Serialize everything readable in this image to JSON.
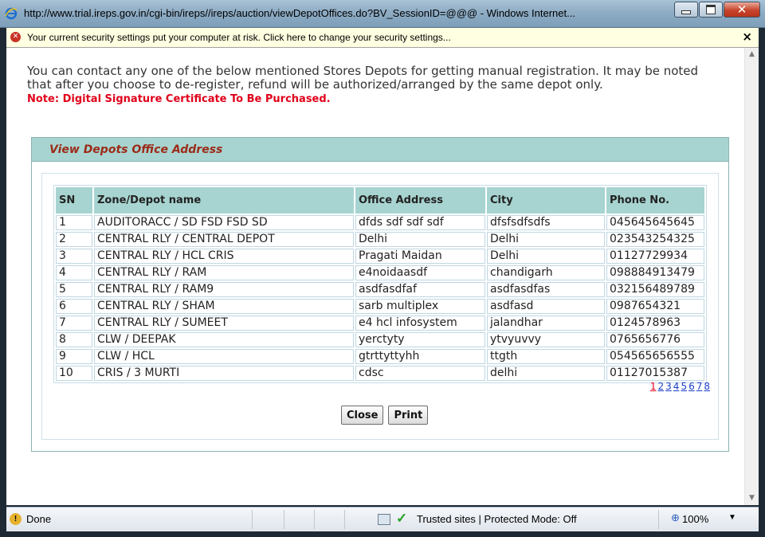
{
  "window": {
    "title": "http://www.trial.ireps.gov.in/cgi-bin/ireps//ireps/auction/viewDepotOffices.do?BV_SessionID=@@@ - Windows Internet..."
  },
  "infobar": {
    "text": "Your current security settings put your computer at risk. Click here to change your security settings...",
    "close_label": "×"
  },
  "intro": {
    "text": "You can contact any one of the below mentioned Stores Depots for getting manual registration. It may be noted that after you choose to de-register, refund will be authorized/arranged by the same depot only.",
    "note_prefix": "Note: Digital Signature Certificate",
    "note_suffix": " To Be Purchased."
  },
  "panel": {
    "title": "View Depots Office Address"
  },
  "table": {
    "headers": [
      "SN",
      "Zone/Depot name",
      "Office Address",
      "City",
      "Phone No."
    ],
    "rows": [
      [
        "1",
        "AUDITORACC / SD FSD FSD SD",
        "dfds sdf sdf sdf",
        "dfsfsdfsdfs",
        "045645645645"
      ],
      [
        "2",
        "CENTRAL RLY / CENTRAL DEPOT",
        "Delhi",
        "Delhi",
        "023543254325"
      ],
      [
        "3",
        "CENTRAL RLY / HCL CRIS",
        "Pragati Maidan",
        "Delhi",
        "01127729934"
      ],
      [
        "4",
        "CENTRAL RLY / RAM",
        "e4noidaasdf",
        "chandigarh",
        "098884913479"
      ],
      [
        "5",
        "CENTRAL RLY / RAM9",
        "asdfasdfaf",
        "asdfasdfas",
        "032156489789"
      ],
      [
        "6",
        "CENTRAL RLY / SHAM",
        "sarb multiplex",
        "asdfasd",
        "0987654321"
      ],
      [
        "7",
        "CENTRAL RLY / SUMEET",
        "e4 hcl infosystem",
        "jalandhar",
        "0124578963"
      ],
      [
        "8",
        "CLW / DEEPAK",
        "yerctyty",
        "ytvyuvvy",
        "0765656776"
      ],
      [
        "9",
        "CLW / HCL",
        "gtrttyttyhh",
        "ttgth",
        "054565656555"
      ],
      [
        "10",
        "CRIS / 3 MURTI",
        "cdsc",
        "delhi",
        "01127015387"
      ]
    ]
  },
  "pager": {
    "pages": [
      "1",
      "2",
      "3",
      "4",
      "5",
      "6",
      "7",
      "8"
    ],
    "current": "1",
    "current_color": "#e0001a",
    "link_color": "#1a3ec9"
  },
  "buttons": {
    "close_label": "Close",
    "print_label": "Print"
  },
  "statusbar": {
    "status": "Done",
    "zone": "Trusted sites | Protected Mode: Off",
    "zoom": "100%"
  },
  "colors": {
    "header_bg": "#a7d4d0",
    "panel_title": "#9b2b18",
    "note": "#e0001a"
  },
  "icons": [
    "ie-icon",
    "shield-icon",
    "warning-icon",
    "zone-icon",
    "check-icon",
    "zoom-icon"
  ]
}
